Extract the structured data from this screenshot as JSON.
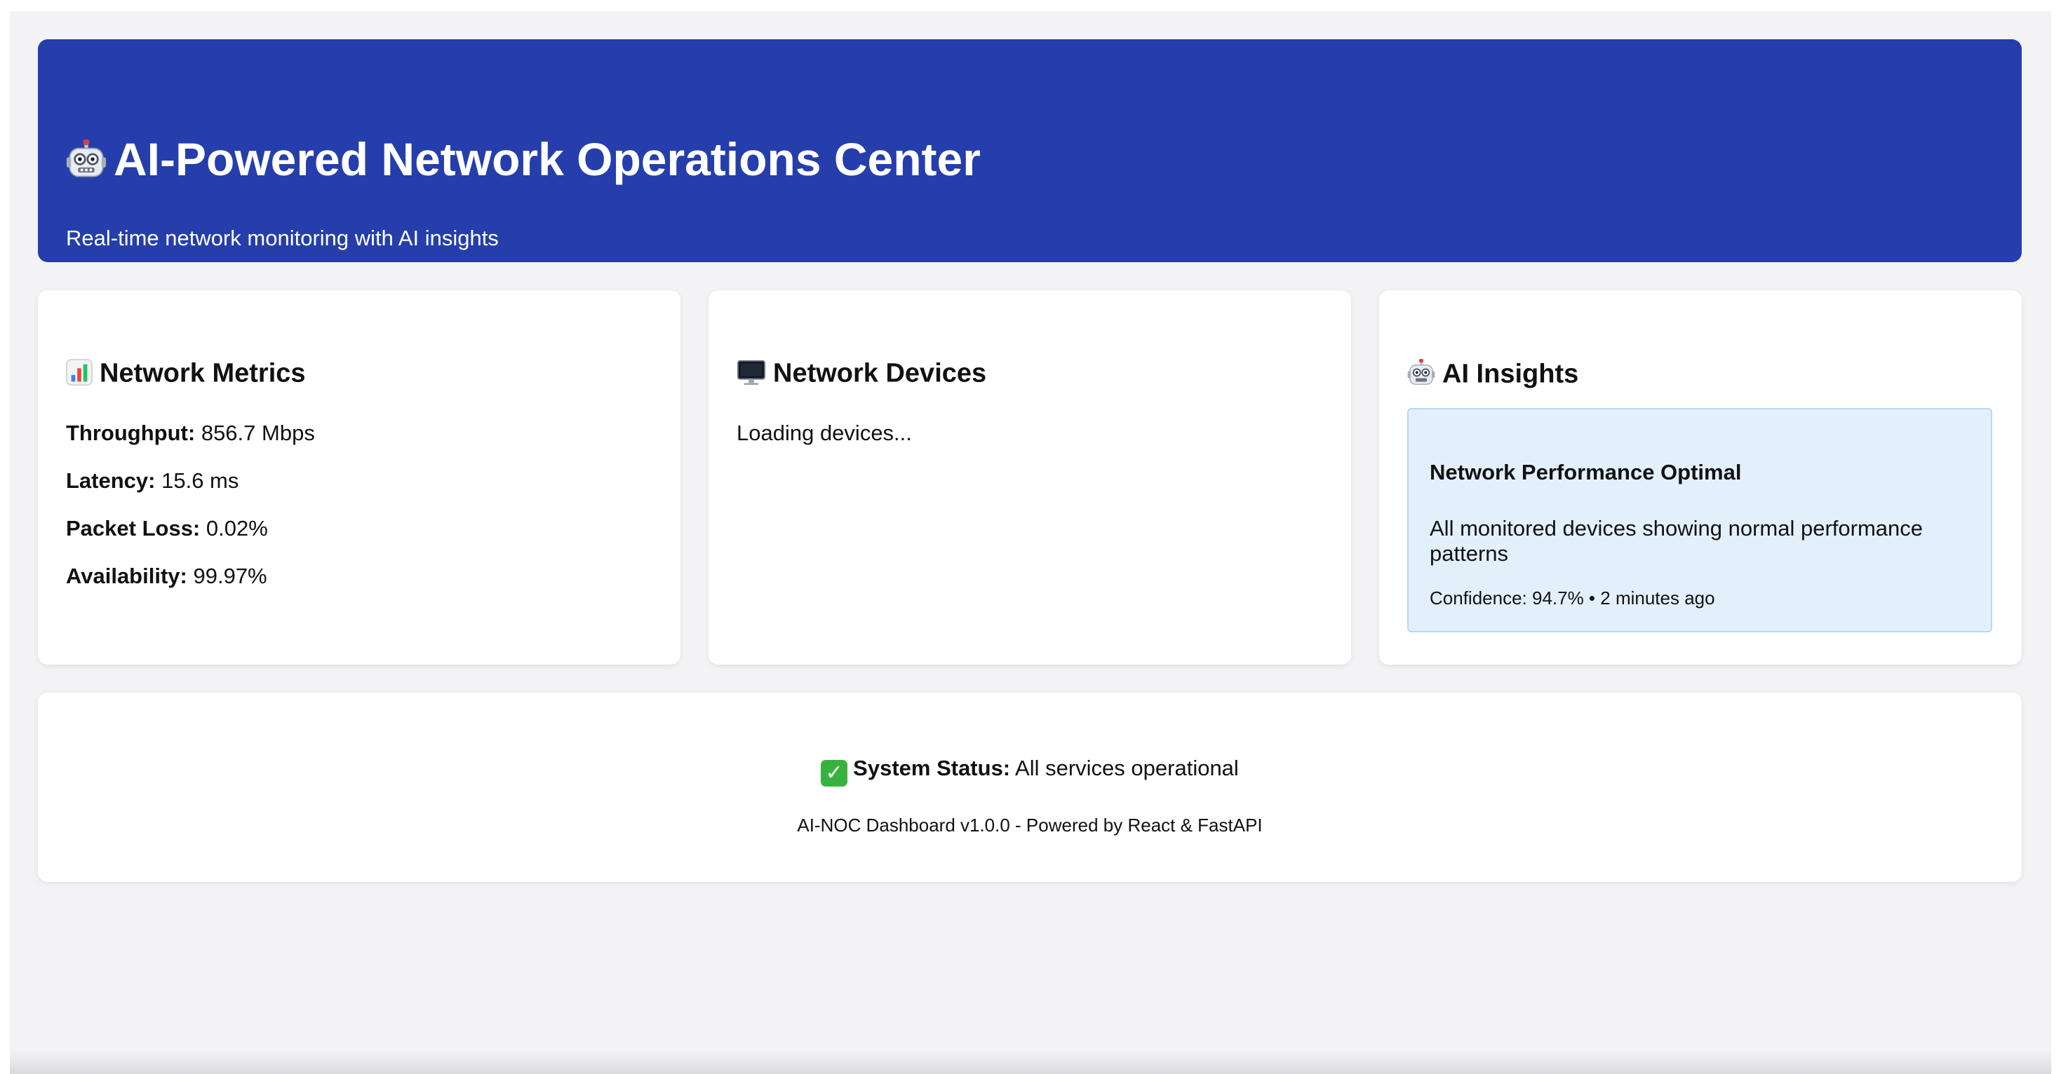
{
  "header": {
    "title": "AI-Powered Network Operations Center",
    "subtitle": "Real-time network monitoring with AI insights",
    "icon": "robot-icon"
  },
  "metrics_card": {
    "title": "Network Metrics",
    "icon": "bar-chart-icon",
    "items": [
      {
        "label": "Throughput:",
        "value": "856.7 Mbps"
      },
      {
        "label": "Latency:",
        "value": "15.6 ms"
      },
      {
        "label": "Packet Loss:",
        "value": "0.02%"
      },
      {
        "label": "Availability:",
        "value": "99.97%"
      }
    ]
  },
  "devices_card": {
    "title": "Network Devices",
    "icon": "monitor-icon",
    "loading_text": "Loading devices..."
  },
  "insights_card": {
    "title": "AI Insights",
    "icon": "robot-icon",
    "insight": {
      "title": "Network Performance Optimal",
      "description": "All monitored devices showing normal performance patterns",
      "meta": "Confidence: 94.7% • 2 minutes ago"
    }
  },
  "status": {
    "icon": "check-icon",
    "label": "System Status:",
    "value": "All services operational",
    "footer": "AI-NOC Dashboard v1.0.0 - Powered by React & FastAPI"
  },
  "colors": {
    "header_bg": "#253eac",
    "page_bg": "#f3f3f5",
    "insight_bg": "#e3f0fb",
    "insight_border": "#b8d7f2",
    "check_green": "#38b23f"
  }
}
